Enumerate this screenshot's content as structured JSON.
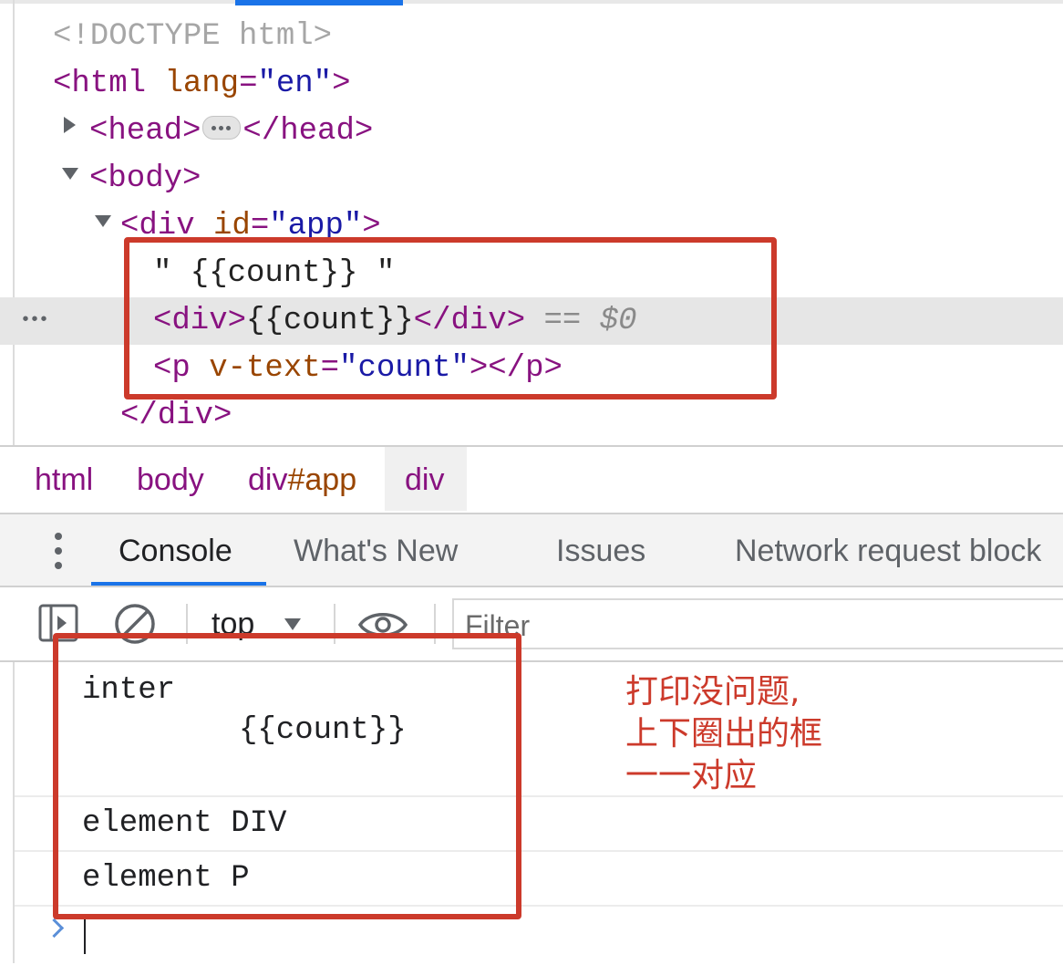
{
  "elements_tree": {
    "doctype": "<!DOCTYPE html>",
    "html_open_tag": "<html",
    "html_attr_name": "lang",
    "html_attr_value": "\"en\"",
    "html_open_close": ">",
    "head_open": "<head>",
    "head_close": "</head>",
    "body_open": "<body>",
    "div_open_tag": "<div",
    "div_attr_name": "id",
    "div_attr_value": "\"app\"",
    "div_open_close": ">",
    "text_node": "\" {{count}} \"",
    "inner_div_open": "<div>",
    "inner_div_text": "{{count}}",
    "inner_div_close": "</div>",
    "selected_suffix_eq": "==",
    "selected_suffix_ref": "$0",
    "p_open_tag": "<p",
    "p_attr_name": "v-text",
    "p_attr_value": "\"count\"",
    "p_open_close": ">",
    "p_close": "</p>",
    "div_close": "</div>",
    "row_gutter_dots": "•••"
  },
  "breadcrumb": {
    "items": [
      {
        "tag": "html",
        "id": ""
      },
      {
        "tag": "body",
        "id": ""
      },
      {
        "tag": "div",
        "id": "#app"
      },
      {
        "tag": "div",
        "id": ""
      }
    ]
  },
  "drawer": {
    "tabs": [
      {
        "label": "Console"
      },
      {
        "label": "What's New"
      },
      {
        "label": "Issues"
      },
      {
        "label": "Network request block"
      }
    ]
  },
  "console_toolbar": {
    "context": "top",
    "filter_placeholder": "Filter"
  },
  "console_messages": {
    "m1_line1": "inter",
    "m1_line2": "{{count}}",
    "m2": "element DIV",
    "m3": "element P"
  },
  "annotation": {
    "line1": "打印没问题,",
    "line2": "上下圈出的框",
    "line3": "一一对应",
    "color": "#cc3a2b"
  },
  "colors": {
    "tag": "#881280",
    "attr_name": "#994500",
    "attr_value": "#1a1aa6",
    "accent": "#1a73e8"
  }
}
